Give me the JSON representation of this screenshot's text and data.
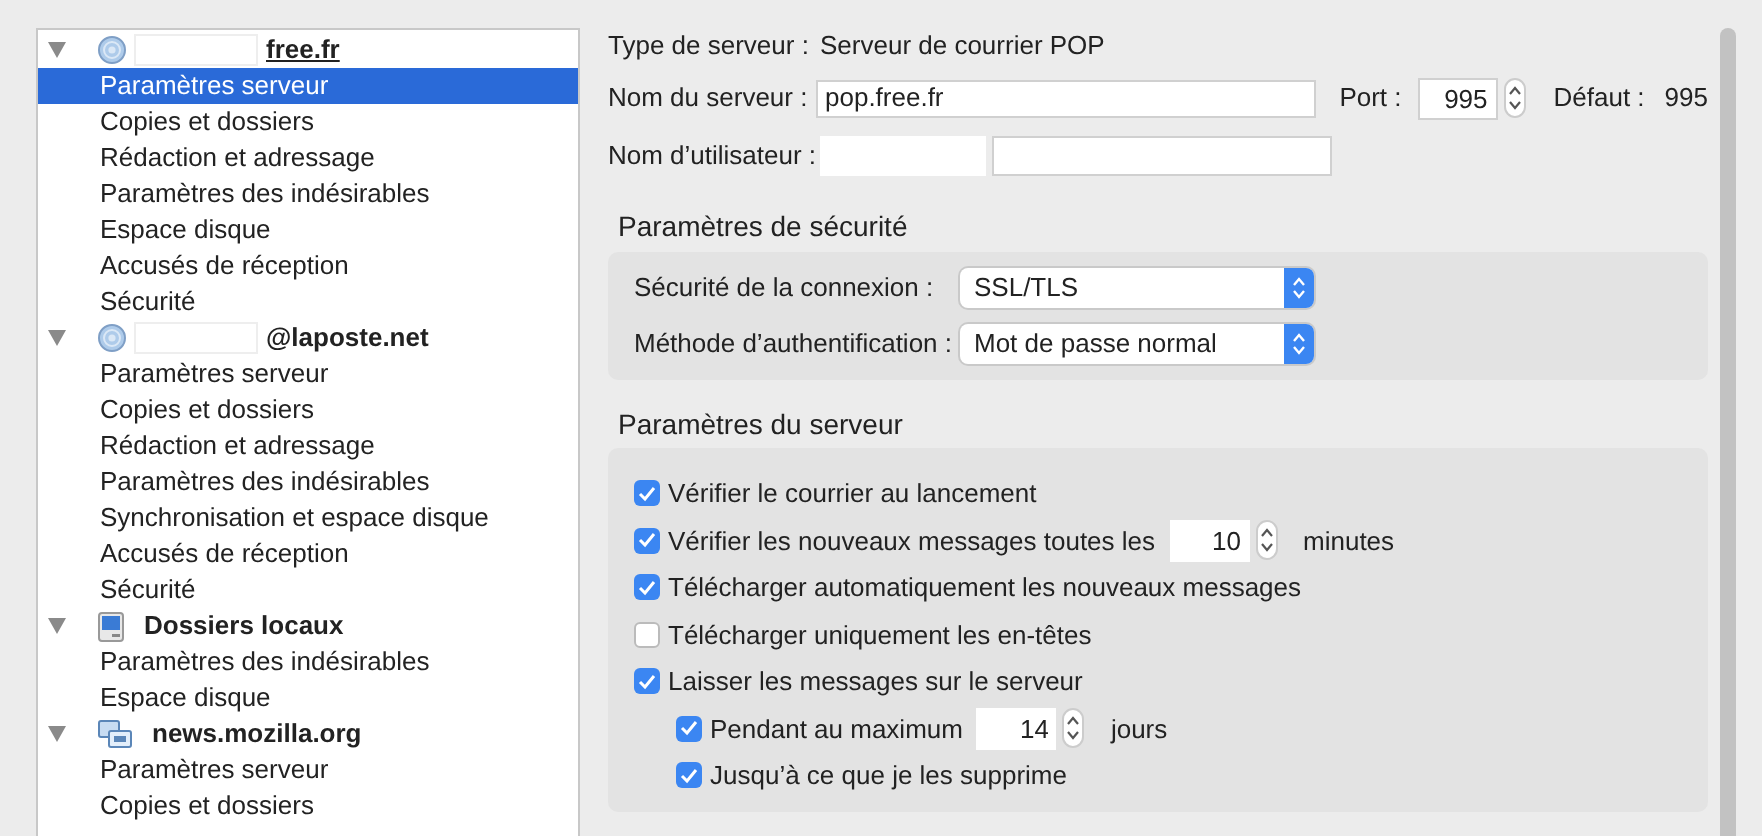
{
  "sidebar": {
    "accounts": [
      {
        "name": "free.fr",
        "kind": "mail",
        "redacted": true,
        "underlined": true,
        "expanded": true,
        "items": [
          {
            "label": "Paramètres serveur",
            "selected": true
          },
          {
            "label": "Copies et dossiers",
            "selected": false
          },
          {
            "label": "Rédaction et adressage",
            "selected": false
          },
          {
            "label": "Paramètres des indésirables",
            "selected": false
          },
          {
            "label": "Espace disque",
            "selected": false
          },
          {
            "label": "Accusés de réception",
            "selected": false
          },
          {
            "label": "Sécurité",
            "selected": false
          }
        ]
      },
      {
        "name": "@laposte.net",
        "kind": "mail",
        "redacted": true,
        "underlined": false,
        "expanded": true,
        "items": [
          {
            "label": "Paramètres serveur",
            "selected": false
          },
          {
            "label": "Copies et dossiers",
            "selected": false
          },
          {
            "label": "Rédaction et adressage",
            "selected": false
          },
          {
            "label": "Paramètres des indésirables",
            "selected": false
          },
          {
            "label": "Synchronisation et espace disque",
            "selected": false
          },
          {
            "label": "Accusés de réception",
            "selected": false
          },
          {
            "label": "Sécurité",
            "selected": false
          }
        ]
      },
      {
        "name": "Dossiers locaux",
        "kind": "local",
        "redacted": false,
        "underlined": false,
        "expanded": true,
        "items": [
          {
            "label": "Paramètres des indésirables",
            "selected": false
          },
          {
            "label": "Espace disque",
            "selected": false
          }
        ]
      },
      {
        "name": "news.mozilla.org",
        "kind": "news",
        "redacted": false,
        "underlined": false,
        "expanded": true,
        "items": [
          {
            "label": "Paramètres serveur",
            "selected": false
          },
          {
            "label": "Copies et dossiers",
            "selected": false
          }
        ]
      }
    ]
  },
  "server_type": {
    "label": "Type de serveur :",
    "value": "Serveur de courrier POP"
  },
  "server_name": {
    "label": "Nom du serveur :",
    "value": "pop.free.fr"
  },
  "port": {
    "label": "Port :",
    "value": "995"
  },
  "default_port": {
    "label": "Défaut :",
    "value": "995"
  },
  "username": {
    "label": "Nom d’utilisateur :"
  },
  "security": {
    "title": "Paramètres de sécurité",
    "rows": [
      {
        "label": "Sécurité de la connexion :",
        "value": "SSL/TLS"
      },
      {
        "label": "Méthode d’authentification :",
        "value": "Mot de passe normal"
      }
    ]
  },
  "server_settings": {
    "title": "Paramètres du serveur",
    "options": [
      {
        "kind": "checkbox",
        "label": "Vérifier le courrier au lancement",
        "checked": true
      },
      {
        "kind": "number",
        "label": "Vérifier les nouveaux messages toutes les",
        "checked": true,
        "value": "10",
        "suffix": "minutes"
      },
      {
        "kind": "checkbox",
        "label": "Télécharger automatiquement les nouveaux messages",
        "checked": true
      },
      {
        "kind": "checkbox",
        "label": "Télécharger uniquement les en-têtes",
        "checked": false
      },
      {
        "kind": "checkbox",
        "label": "Laisser les messages sur le serveur",
        "checked": true,
        "children": [
          {
            "kind": "number",
            "label": "Pendant au maximum",
            "checked": true,
            "value": "14",
            "suffix": "jours"
          },
          {
            "kind": "checkbox",
            "label": "Jusqu’à ce que je les supprime",
            "checked": true
          }
        ]
      }
    ]
  }
}
